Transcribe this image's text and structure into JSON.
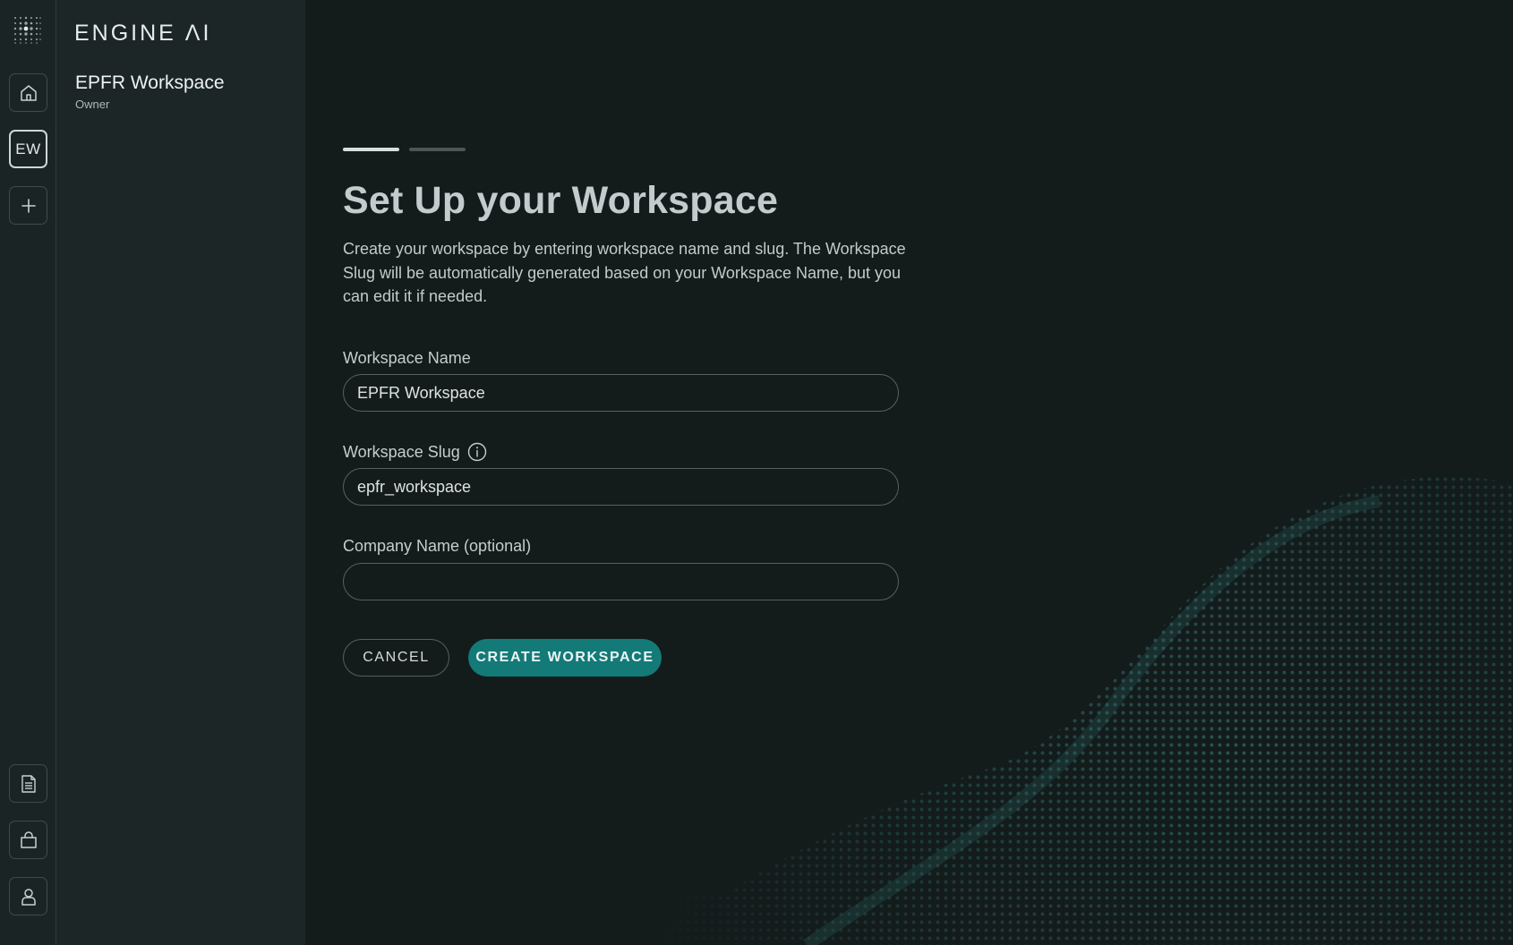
{
  "rail": {
    "items": [
      {
        "name": "home",
        "icon": "home-icon"
      },
      {
        "name": "workspace",
        "initials": "EW"
      },
      {
        "name": "add",
        "icon": "plus-icon"
      },
      {
        "name": "documents",
        "icon": "document-icon"
      },
      {
        "name": "marketplace",
        "icon": "shopping-bag-icon"
      },
      {
        "name": "profile",
        "icon": "user-icon"
      }
    ]
  },
  "panel": {
    "brand": "ENGINE ΛI",
    "workspace_name": "EPFR Workspace",
    "role": "Owner"
  },
  "form": {
    "steps_total": 2,
    "step_current": 1,
    "title": "Set Up your Workspace",
    "description": "Create your workspace by entering workspace name and slug. The Workspace Slug will be automatically generated based on your Workspace Name, but you can edit it if needed.",
    "workspace_name_label": "Workspace Name",
    "workspace_name_value": "EPFR Workspace",
    "workspace_slug_label": "Workspace Slug",
    "workspace_slug_value": "epfr_workspace",
    "company_name_label": "Company Name (optional)",
    "company_name_value": "",
    "cancel_label": "CANCEL",
    "create_label": "CREATE WORKSPACE"
  },
  "colors": {
    "accent": "#137a78",
    "background": "#131b1b",
    "panel": "#1c2626",
    "rail": "#1a2424"
  }
}
